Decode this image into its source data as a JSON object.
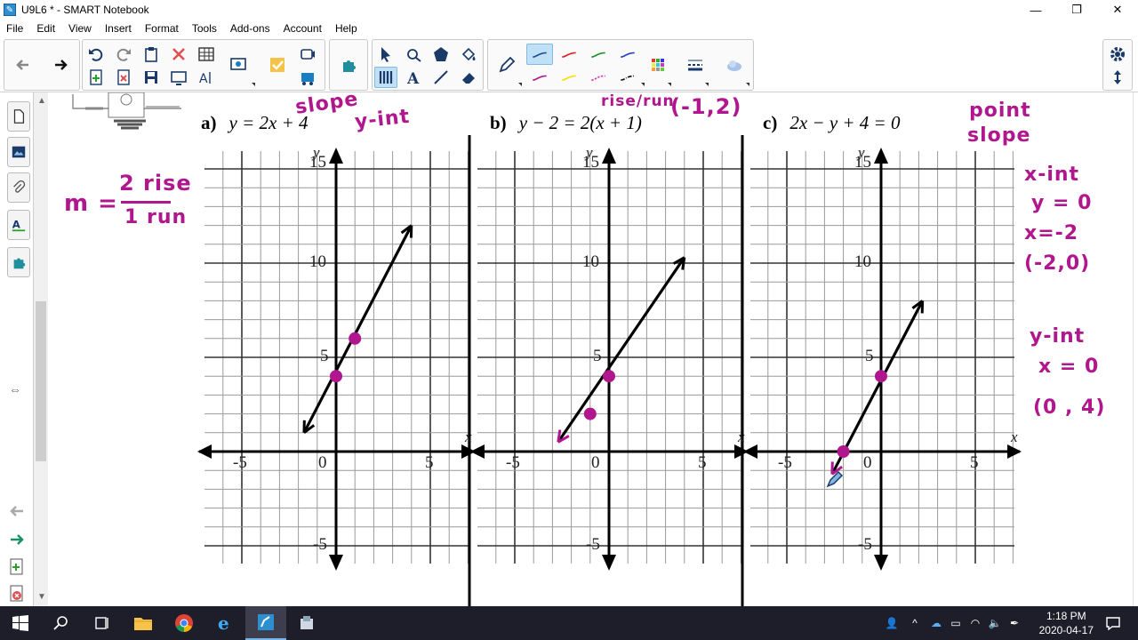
{
  "window": {
    "title": "U9L6 * - SMART Notebook",
    "minimize": "—",
    "maximize": "❐",
    "close": "✕"
  },
  "menu": [
    "File",
    "Edit",
    "View",
    "Insert",
    "Format",
    "Tools",
    "Add-ons",
    "Account",
    "Help"
  ],
  "toolbar": {
    "pen_colors": [
      "#1b4f9c",
      "#e02020",
      "#1a8f2a",
      "#2040c0",
      "#b0168d",
      "#f5e000",
      "#e030c0",
      "#111111"
    ]
  },
  "problems": {
    "a": {
      "letter": "a)",
      "equation": "y = 2x + 4"
    },
    "b": {
      "letter": "b)",
      "equation": "y − 2 = 2(x + 1)"
    },
    "c": {
      "letter": "c)",
      "equation": "2x − y + 4 = 0"
    }
  },
  "axes": {
    "x_label": "x",
    "y_label": "y",
    "ticks": {
      "y15": "15",
      "y10": "10",
      "y5": "5",
      "zero": "0",
      "xneg5": "-5",
      "xpos5": "5",
      "yneg5": "-5"
    }
  },
  "annotations": {
    "slope_m": "m =",
    "slope_rise": "2 rise",
    "slope_run": "1 run",
    "slope": "slope",
    "y_int": "y-int",
    "rise_run_b": "rise/run",
    "point_b": "(-1,2)",
    "point_slope_1": "point",
    "point_slope_2": "slope",
    "x_int_title": "x-int",
    "x_int_y0": "y = 0",
    "x_int_val": "x=-2",
    "x_int_pt": "(-2,0)",
    "y_int_title": "y-int",
    "y_int_x0": "x = 0",
    "y_int_pt": "(0 , 4)"
  },
  "colors": {
    "ink": "#b0168d",
    "canvas": "#ffffff",
    "taskbar": "#1e1e2a"
  },
  "taskbar": {
    "time": "1:18 PM",
    "date": "2020-04-17"
  }
}
